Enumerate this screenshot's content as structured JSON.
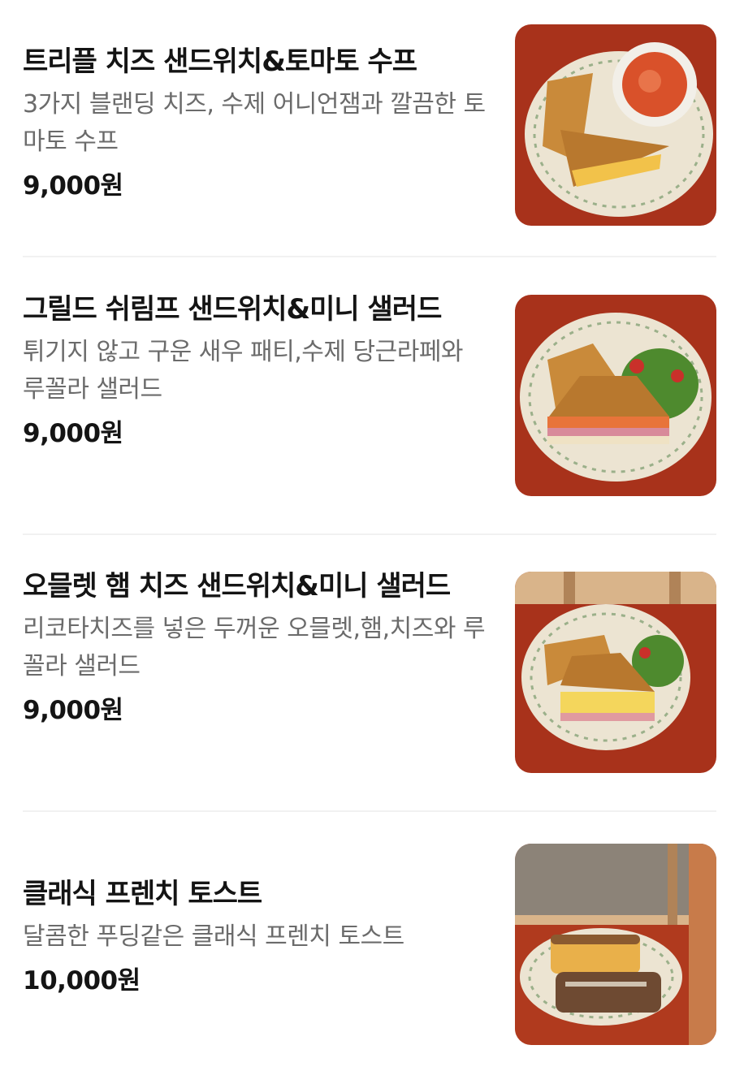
{
  "menu": {
    "items": [
      {
        "name": "트리플 치즈 샌드위치&토마토 수프",
        "description": "3가지 블랜딩 치즈, 수제 어니언잼과 깔끔한 토마토 수프",
        "price": "9,000원",
        "photo_icon": "sandwich-with-tomato-soup-photo"
      },
      {
        "name": "그릴드 쉬림프 샌드위치&미니 샐러드",
        "description": "튀기지 않고 구운 새우 패티,수제 당근라페와 루꼴라 샐러드",
        "price": "9,000원",
        "photo_icon": "shrimp-sandwich-salad-photo"
      },
      {
        "name": "오믈렛 햄 치즈 샌드위치&미니 샐러드",
        "description": "리코타치즈를 넣은 두꺼운 오믈렛,햄,치즈와 루꼴라 샐러드",
        "price": "9,000원",
        "photo_icon": "omelette-ham-sandwich-photo"
      },
      {
        "name": "클래식 프렌치 토스트",
        "description": "달콤한 푸딩같은 클래식 프렌치 토스트",
        "price": "10,000원",
        "photo_icon": "french-toast-photo"
      }
    ]
  },
  "colors": {
    "table_red": "#a8321b",
    "plate": "#ece4d2",
    "toast": "#b8782e",
    "divider": "#f1f1f1"
  }
}
